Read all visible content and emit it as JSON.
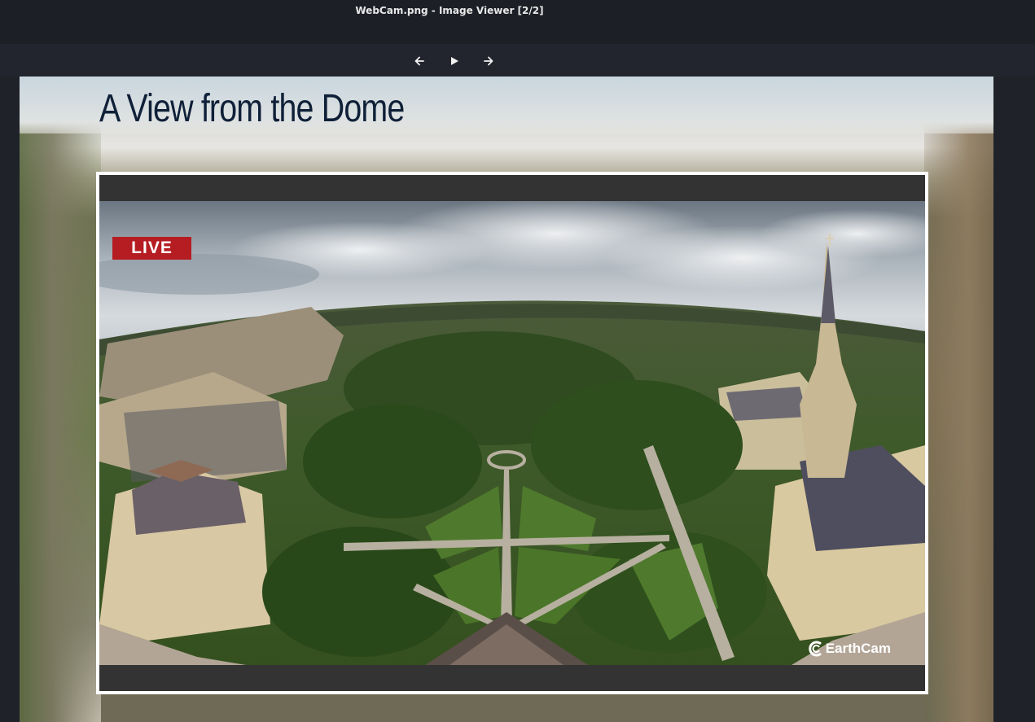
{
  "window": {
    "title": "WebCam.png - Image Viewer [2/2]"
  },
  "toolbar": {
    "prev_icon": "arrow-left-icon",
    "play_icon": "play-icon",
    "next_icon": "arrow-right-icon"
  },
  "image": {
    "heading": "A View from the Dome",
    "live_label": "LIVE",
    "brand": "EarthCam",
    "colors": {
      "live_badge": "#b51d22",
      "heading": "#0f2038",
      "player_frame": "#ffffff",
      "player_bar": "#333333"
    }
  }
}
